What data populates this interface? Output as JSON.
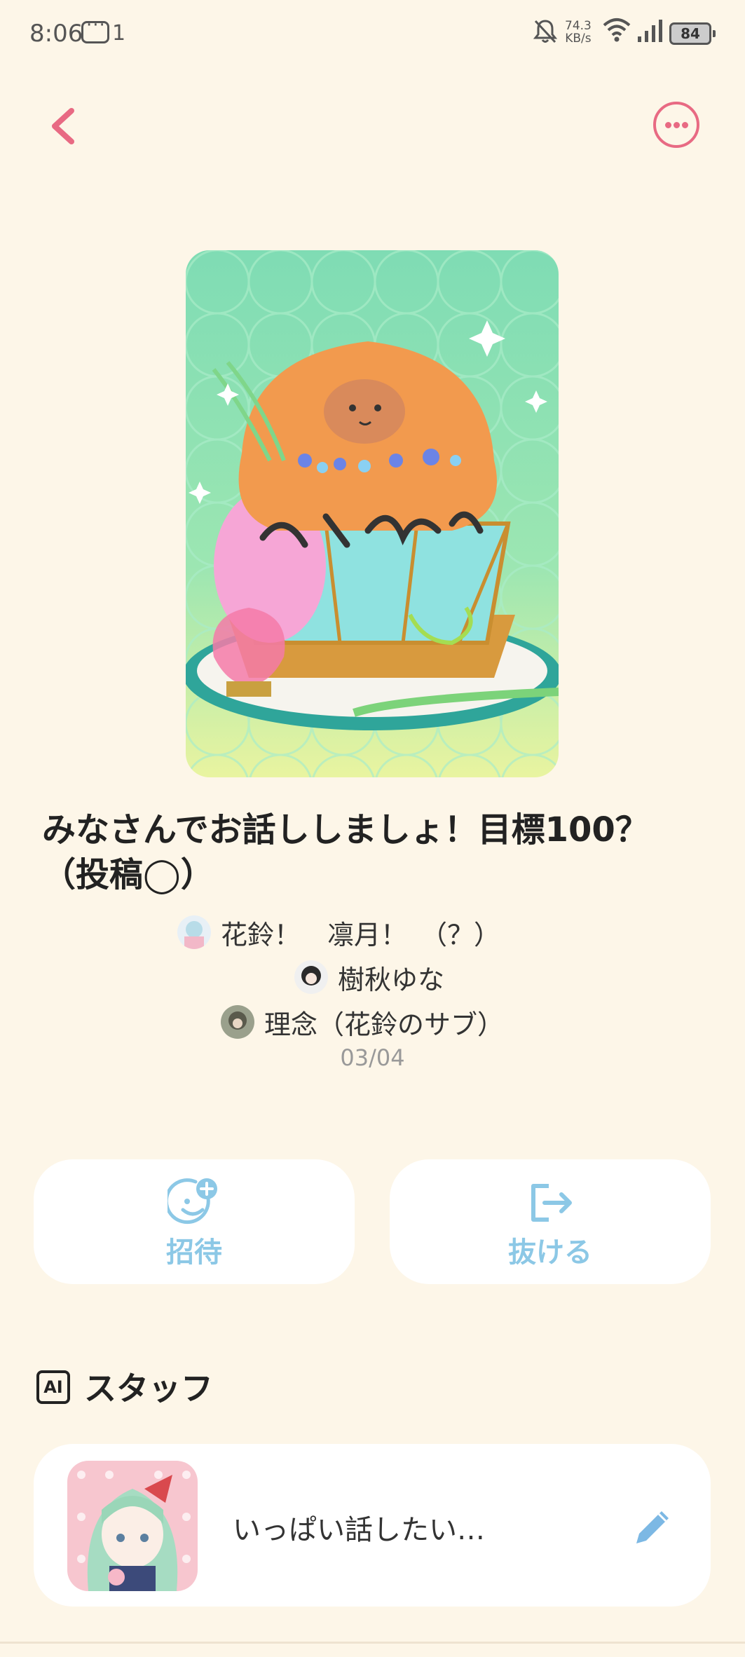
{
  "status_bar": {
    "time": "8:06",
    "notification_count": "1",
    "speed_top": "74.3",
    "speed_bottom": "KB/s",
    "battery": "84"
  },
  "nav": {
    "back_icon": "chevron-left-icon",
    "more_icon": "more-dots-icon"
  },
  "group": {
    "title": "みなさんでお話ししましょ！目標100？（投稿◯）",
    "members": [
      {
        "name": "花鈴！　凛月！　（？）"
      },
      {
        "name": "樹秋ゆな"
      },
      {
        "name": "理念（花鈴のサブ）"
      }
    ],
    "date": "03/04"
  },
  "actions": {
    "invite_label": "招待",
    "leave_label": "抜ける"
  },
  "staff": {
    "badge": "AI",
    "section_title": "スタッフ",
    "message": "いっぱい話したい…"
  },
  "colors": {
    "accent_pink": "#e86a83",
    "accent_blue": "#8cc8e6",
    "background": "#fdf6e8"
  }
}
